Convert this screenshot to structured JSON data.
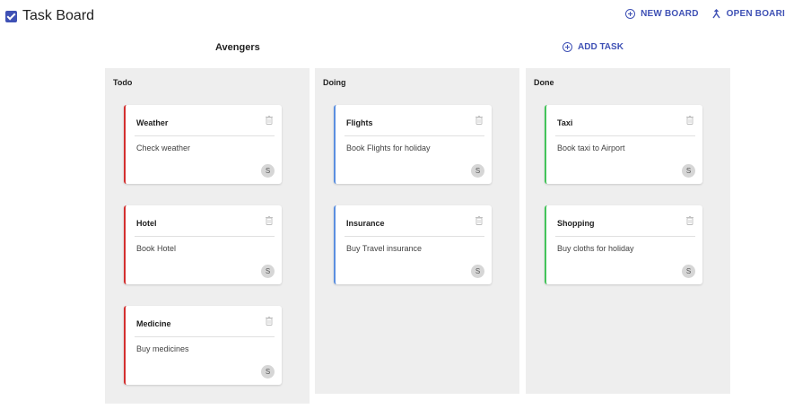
{
  "header": {
    "app_title": "Task Board",
    "new_board_label": "NEW BOARD",
    "open_board_label": "OPEN BOARI"
  },
  "board": {
    "name": "Avengers",
    "add_task_label": "ADD TASK"
  },
  "columns": [
    {
      "title": "Todo",
      "accent": "#d32f2f",
      "cards": [
        {
          "title": "Weather",
          "description": "Check weather",
          "assignee": "S"
        },
        {
          "title": "Hotel",
          "description": "Book Hotel",
          "assignee": "S"
        },
        {
          "title": "Medicine",
          "description": "Buy medicines",
          "assignee": "S"
        }
      ]
    },
    {
      "title": "Doing",
      "accent": "#5b8fe0",
      "cards": [
        {
          "title": "Flights",
          "description": "Book Flights for holiday",
          "assignee": "S"
        },
        {
          "title": "Insurance",
          "description": "Buy Travel insurance",
          "assignee": "S"
        }
      ]
    },
    {
      "title": "Done",
      "accent": "#43c45a",
      "cards": [
        {
          "title": "Taxi",
          "description": "Book taxi to Airport",
          "assignee": "S"
        },
        {
          "title": "Shopping",
          "description": "Buy cloths for holiday",
          "assignee": "S"
        }
      ]
    }
  ],
  "colors": {
    "primary": "#3f51b5",
    "column_bg": "#eeeeee"
  },
  "icons": {
    "title_icon": "check-box-icon",
    "new_board_icon": "add-circle-icon",
    "open_board_icon": "merge-icon",
    "add_task_icon": "add-circle-icon",
    "card_delete_icon": "trash-icon"
  }
}
